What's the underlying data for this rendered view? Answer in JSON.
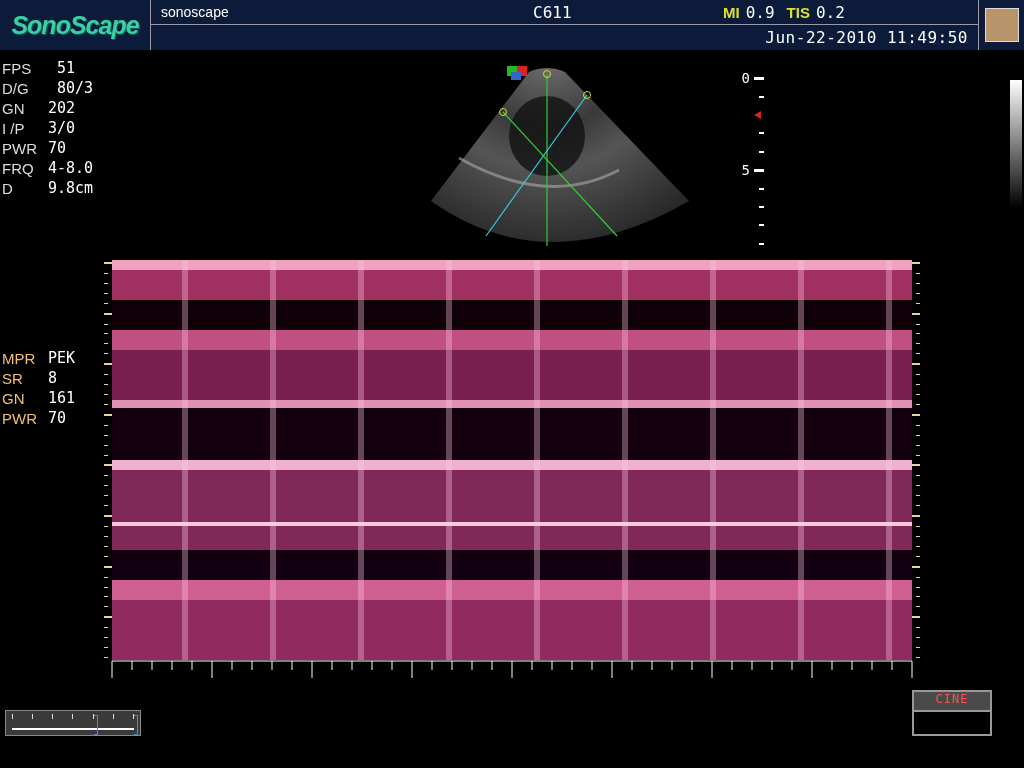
{
  "header": {
    "logo": "SonoScape",
    "hospital": "sonoscape",
    "probe": "C611",
    "mi_label": "MI",
    "mi": "0.9",
    "tis_label": "TIS",
    "tis": "0.2",
    "datetime": "Jun-22-2010 11:49:50"
  },
  "b_params": [
    {
      "label": "FPS",
      "value": " 51"
    },
    {
      "label": "D/G",
      "value": " 80/3"
    },
    {
      "label": "GN",
      "value": "202"
    },
    {
      "label": "I /P",
      "value": "3/0"
    },
    {
      "label": "PWR",
      "value": "70"
    },
    {
      "label": "FRQ",
      "value": "4-8.0"
    },
    {
      "label": "D",
      "value": "9.8cm"
    }
  ],
  "depth_labels": [
    "0",
    "5"
  ],
  "m_params": [
    {
      "label": "MPR",
      "value": "PEK"
    },
    {
      "label": "SR",
      "value": "8"
    },
    {
      "label": "GN",
      "value": "161"
    },
    {
      "label": "PWR",
      "value": "70"
    }
  ],
  "cine": {
    "label": "CINE"
  }
}
